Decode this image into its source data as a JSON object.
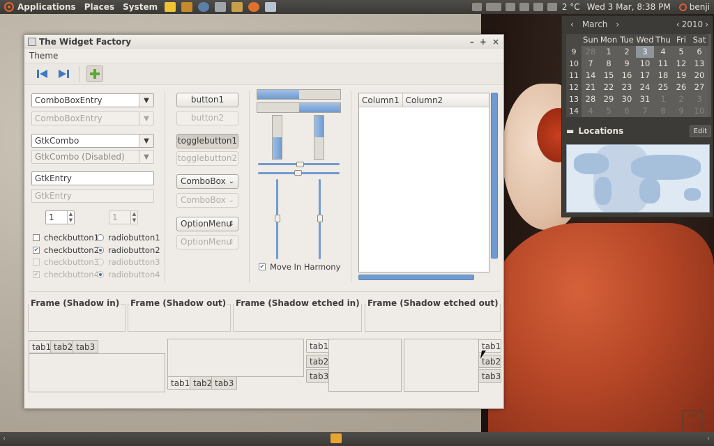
{
  "top_panel": {
    "menus": [
      "Applications",
      "Places",
      "System"
    ],
    "weather": "2 °C",
    "clock": "Wed  3 Mar,  8:38 PM",
    "user": "benji"
  },
  "calendar": {
    "month": "March",
    "year": "2010",
    "weekdays": [
      "Sun",
      "Mon",
      "Tue",
      "Wed",
      "Thu",
      "Fri",
      "Sat"
    ],
    "weeks": [
      {
        "wk": "9",
        "days": [
          "28",
          "1",
          "2",
          "3",
          "4",
          "5",
          "6"
        ]
      },
      {
        "wk": "10",
        "days": [
          "7",
          "8",
          "9",
          "10",
          "11",
          "12",
          "13"
        ]
      },
      {
        "wk": "11",
        "days": [
          "14",
          "15",
          "16",
          "17",
          "18",
          "19",
          "20"
        ]
      },
      {
        "wk": "12",
        "days": [
          "21",
          "22",
          "23",
          "24",
          "25",
          "26",
          "27"
        ]
      },
      {
        "wk": "13",
        "days": [
          "28",
          "29",
          "30",
          "31",
          "1",
          "2",
          "3"
        ]
      },
      {
        "wk": "14",
        "days": [
          "4",
          "5",
          "6",
          "7",
          "8",
          "9",
          "10"
        ]
      }
    ],
    "selected_day": "3",
    "locations_label": "Locations",
    "edit_label": "Edit"
  },
  "window": {
    "title": "The Widget Factory",
    "menu": [
      "Theme"
    ],
    "controls": [
      "–",
      "+",
      "×"
    ]
  },
  "col1": {
    "combo_entry": "ComboBoxEntry",
    "combo_entry_dis": "ComboBoxEntry",
    "gtk_combo": "GtkCombo",
    "gtk_combo_dis": "GtkCombo (Disabled)",
    "entry": "GtkEntry",
    "entry_dis": "GtkEntry",
    "spin": "1",
    "spin_dis": "1",
    "checks": [
      "checkbutton1",
      "checkbutton2",
      "checkbutton3",
      "checkbutton4"
    ],
    "radios": [
      "radiobutton1",
      "radiobutton2",
      "radiobutton3",
      "radiobutton4"
    ]
  },
  "col2": {
    "button1": "button1",
    "button2": "button2",
    "toggle1": "togglebutton1",
    "toggle2": "togglebutton2",
    "combobox": "ComboBox",
    "combobox_dis": "ComboBox",
    "option": "OptionMenu",
    "option_dis": "OptionMenu"
  },
  "col3": {
    "harmony": "Move In Harmony",
    "progress_top": 0.5,
    "progress_bottom": 0.5
  },
  "tree": {
    "columns": [
      "Column1",
      "Column2"
    ]
  },
  "frames": [
    "Frame (Shadow in)",
    "Frame (Shadow out)",
    "Frame (Shadow etched in)",
    "Frame (Shadow etched out)"
  ],
  "notebooks": {
    "tabs": [
      "tab1",
      "tab2",
      "tab3"
    ]
  },
  "desktop": {
    "signature": "SIN LAU"
  }
}
